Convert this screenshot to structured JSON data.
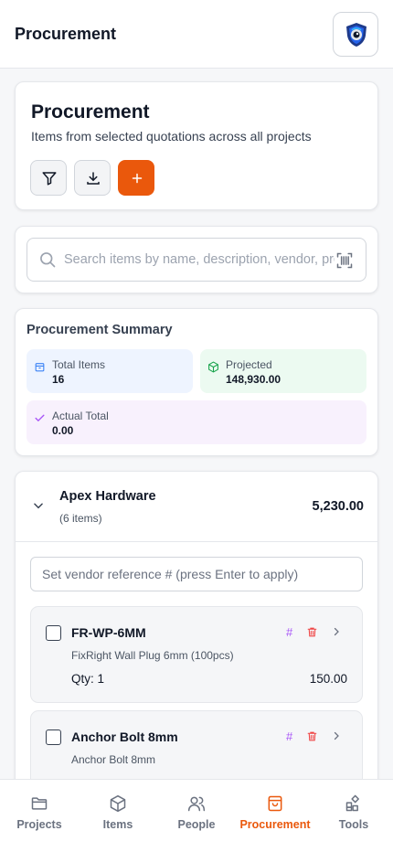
{
  "app": {
    "title": "Procurement",
    "logo": "shield-eye-logo"
  },
  "header": {
    "title": "Procurement",
    "subtitle": "Items from selected quotations across all projects",
    "actions": [
      {
        "icon": "filter-icon"
      },
      {
        "icon": "download-icon"
      },
      {
        "icon": "plus-icon"
      }
    ]
  },
  "search": {
    "placeholder": "Search items by name, description, vendor, pro",
    "value": "",
    "scan_icon": "barcode-scan-icon"
  },
  "summary": {
    "title": "Procurement Summary",
    "total_items": {
      "label": "Total Items",
      "value": "16"
    },
    "projected": {
      "label": "Projected",
      "value": "148,930.00"
    },
    "actual_total": {
      "label": "Actual Total",
      "value": "0.00"
    }
  },
  "vendor": {
    "name": "Apex Hardware",
    "count": "(6 items)",
    "total": "5,230.00",
    "reference_placeholder": "Set vendor reference # (press Enter to apply)",
    "items": [
      {
        "code": "FR-WP-6MM",
        "description": "FixRight Wall Plug 6mm (100pcs)",
        "qty": "Qty: 1",
        "price": "150.00",
        "hash": "#"
      },
      {
        "code": "Anchor Bolt 8mm",
        "description": "Anchor Bolt 8mm",
        "qty": "",
        "price": "",
        "hash": "#"
      }
    ]
  },
  "nav": [
    {
      "label": "Projects",
      "icon": "folder-icon"
    },
    {
      "label": "Items",
      "icon": "box-icon"
    },
    {
      "label": "People",
      "icon": "people-icon"
    },
    {
      "label": "Procurement",
      "icon": "shopping-bag-icon",
      "active": true
    },
    {
      "label": "Tools",
      "icon": "tools-grid-icon"
    }
  ],
  "colors": {
    "accent": "#ea580c",
    "purple": "#a855f7",
    "danger": "#ef4444"
  }
}
